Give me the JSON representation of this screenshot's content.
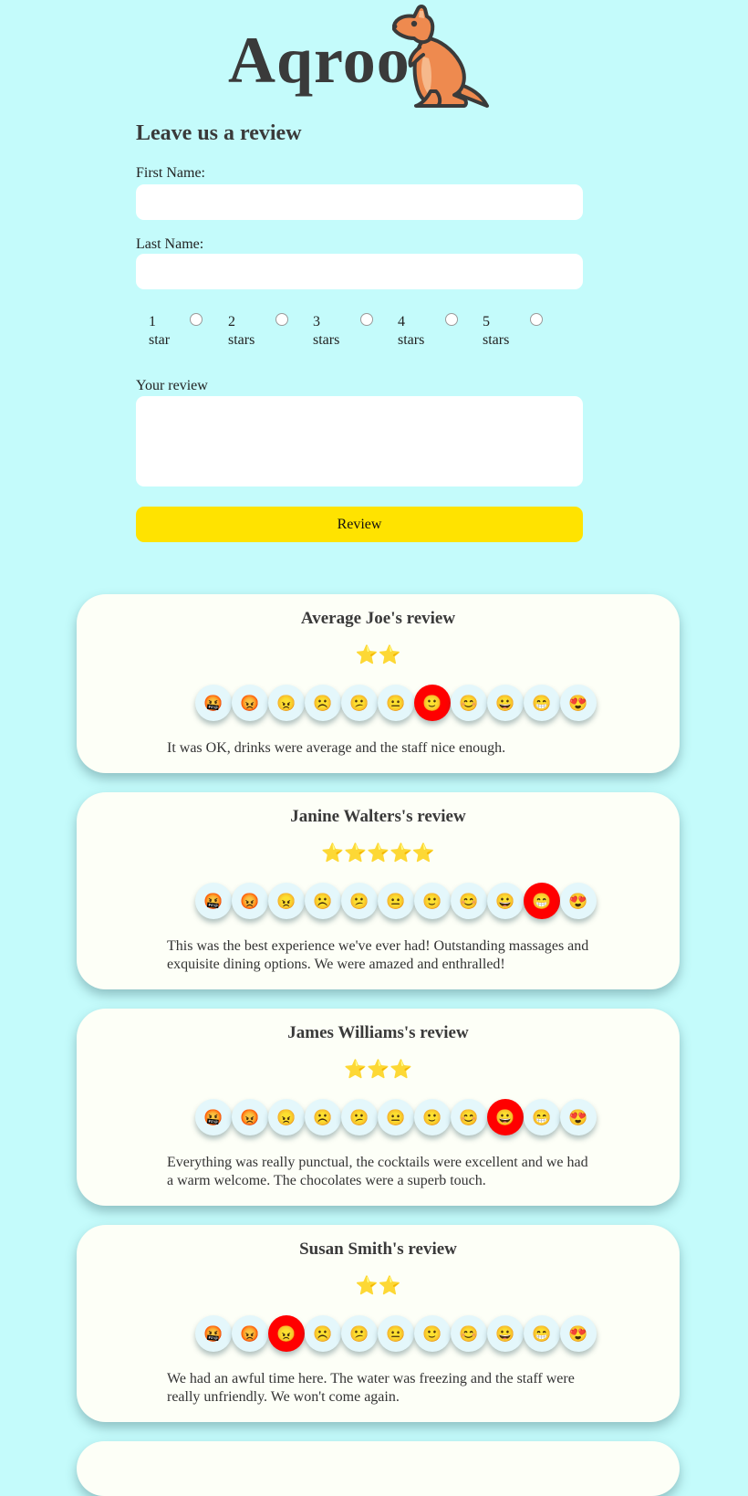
{
  "brand": {
    "name": "Aqroo",
    "icon": "kangaroo-icon"
  },
  "form": {
    "title": "Leave us a review",
    "first_name_label": "First Name:",
    "first_name_value": "",
    "last_name_label": "Last Name:",
    "last_name_value": "",
    "rating_options": [
      {
        "line1": "1",
        "line2": "star"
      },
      {
        "line1": "2",
        "line2": "stars"
      },
      {
        "line1": "3",
        "line2": "stars"
      },
      {
        "line1": "4",
        "line2": "stars"
      },
      {
        "line1": "5",
        "line2": "stars"
      }
    ],
    "review_label": "Your review",
    "review_value": "",
    "submit_label": "Review",
    "submit_color": "#ffe300"
  },
  "emoji_scale": [
    "🤬",
    "😡",
    "😠",
    "☹️",
    "😕",
    "😐",
    "🙂",
    "😊",
    "😀",
    "😁",
    "😍"
  ],
  "selected_color": "#ff0000",
  "reviews": [
    {
      "title": "Average Joe's review",
      "stars": "⭐⭐",
      "star_count": 2,
      "mood_index": 6,
      "text": "It was OK, drinks were average and the staff nice enough."
    },
    {
      "title": "Janine Walters's review",
      "stars": "⭐⭐⭐⭐⭐",
      "star_count": 5,
      "mood_index": 9,
      "text": "This was the best experience we've ever had! Outstanding massages and exquisite dining options. We were amazed and enthralled!"
    },
    {
      "title": "James Williams's review",
      "stars": "⭐⭐⭐",
      "star_count": 3,
      "mood_index": 8,
      "text": "Everything was really punctual, the cocktails were excellent and we had a warm welcome. The chocolates were a superb touch."
    },
    {
      "title": "Susan Smith's review",
      "stars": "⭐⭐",
      "star_count": 2,
      "mood_index": 2,
      "text": "We had an awful time here. The water was freezing and the staff were really unfriendly. We won't come again."
    }
  ]
}
